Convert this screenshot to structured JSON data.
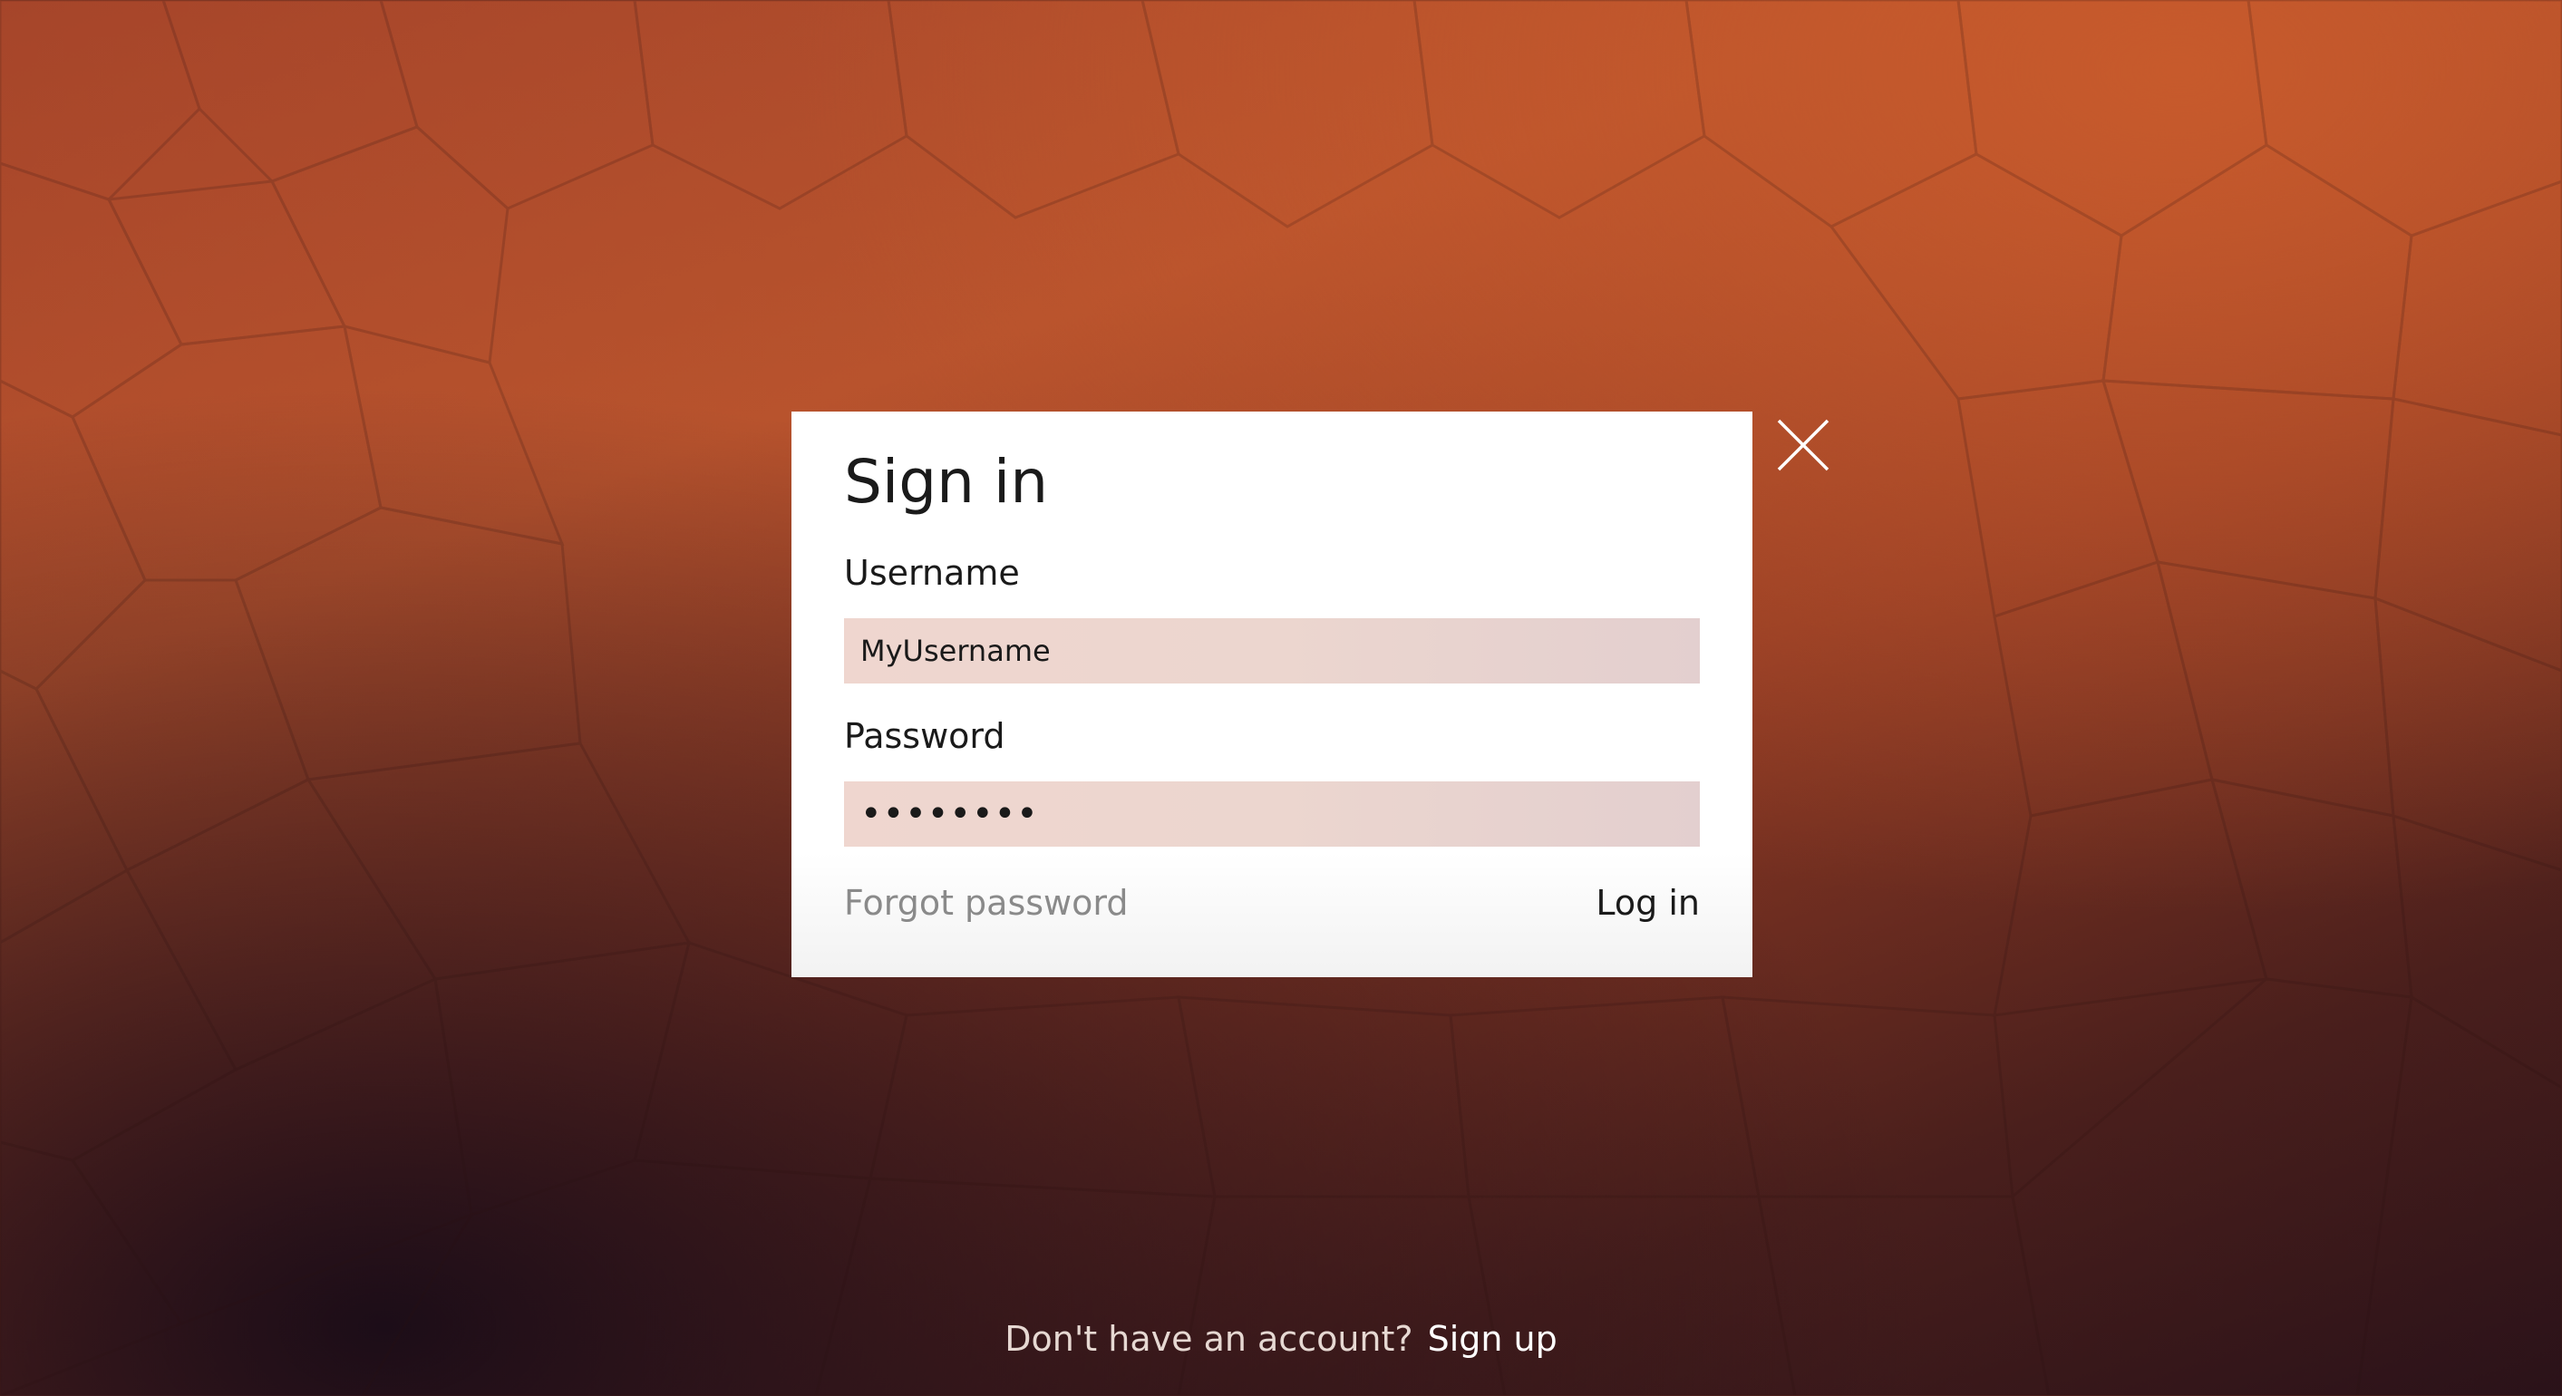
{
  "colors": {
    "dialog_bg": "#ffffff",
    "field_bg": "#ecd6cf",
    "text_primary": "#1a1a1a",
    "text_muted": "#8a8a8a",
    "footer_text": "#e6d8d2"
  },
  "dialog": {
    "title": "Sign in",
    "username_label": "Username",
    "username_value": "MyUsername",
    "password_label": "Password",
    "password_value": "••••••••",
    "forgot_label": "Forgot password",
    "login_label": "Log in",
    "close_icon": "close-icon"
  },
  "footer": {
    "question": "Don't have an account?",
    "signup_label": "Sign up"
  }
}
